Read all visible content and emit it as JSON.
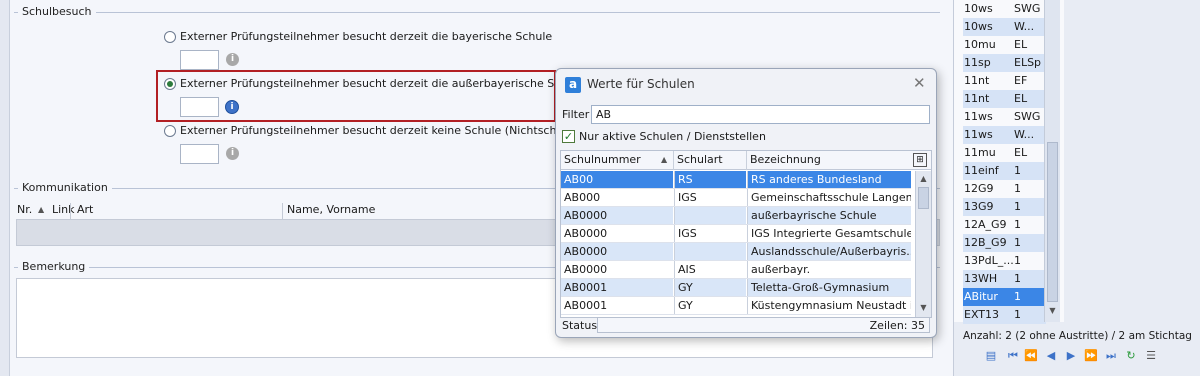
{
  "schulbesuch": {
    "section_title": "Schulbesuch",
    "option_bayern": "Externer Prüfungsteilnehmer besucht derzeit die bayerische Schule",
    "option_ausserbayern": "Externer Prüfungsteilnehmer besucht derzeit die außerbayerische Schule",
    "option_keine": "Externer Prüfungsteilnehmer besucht derzeit keine Schule (Nichtschüler);",
    "selected": "ausserbayern"
  },
  "kommunikation": {
    "section_title": "Kommunikation",
    "columns": [
      "Nr.",
      "Link",
      "Art",
      "Name, Vorname"
    ]
  },
  "bemerkung": {
    "section_title": "Bemerkung"
  },
  "dialog": {
    "title": "Werte für Schulen",
    "app_icon_letter": "a",
    "filter_label": "Filter",
    "filter_value": "AB",
    "checkbox_label": "Nur aktive Schulen / Dienststellen",
    "checkbox_checked": true,
    "columns": [
      "Schulnummer",
      "Schulart",
      "Bezeichnung"
    ],
    "rows": [
      [
        "AB00",
        "RS",
        "RS anderes Bundesland"
      ],
      [
        "AB000",
        "IGS",
        "Gemeinschaftsschule Langen..."
      ],
      [
        "AB0000",
        "",
        "außerbayrische Schule"
      ],
      [
        "AB0000",
        "IGS",
        "IGS Integrierte Gesamtschule ..."
      ],
      [
        "AB0000",
        "",
        "Auslandsschule/Außerbayris..."
      ],
      [
        "AB0000",
        "AIS",
        "außerbayr."
      ],
      [
        "AB0001",
        "GY",
        "Teletta-Groß-Gymnasium"
      ],
      [
        "AB0001",
        "GY",
        "Küstengymnasium Neustadt i..."
      ]
    ],
    "status_label": "Status",
    "rows_count": "Zeilen: 35"
  },
  "class_list": {
    "rows": [
      [
        "10ws",
        "SWG"
      ],
      [
        "10ws",
        "W..."
      ],
      [
        "10mu",
        "EL"
      ],
      [
        "11sp",
        "ELSp"
      ],
      [
        "11nt",
        "EF"
      ],
      [
        "11nt",
        "EL"
      ],
      [
        "11ws",
        "SWG"
      ],
      [
        "11ws",
        "W..."
      ],
      [
        "11mu",
        "EL"
      ],
      [
        "11einf",
        "1"
      ],
      [
        "12G9",
        "1"
      ],
      [
        "13G9",
        "1"
      ],
      [
        "12A_G9",
        "1"
      ],
      [
        "12B_G9",
        "1"
      ],
      [
        "13PdL_...",
        "1"
      ],
      [
        "13WH",
        "1"
      ],
      [
        "ABitur",
        "1"
      ],
      [
        "EXT13",
        "1"
      ]
    ],
    "selected_index": 16,
    "count_text": "Anzahl: 2 (2 ohne Austritte) / 2 am Stichtag"
  },
  "icons": {
    "info": "info-icon",
    "close": "close-icon",
    "sort": "sort-ascending-icon"
  },
  "colors": {
    "highlight_border": "#b21f24",
    "selection": "#3b86e6",
    "alt_row": "#d9e6f8"
  }
}
